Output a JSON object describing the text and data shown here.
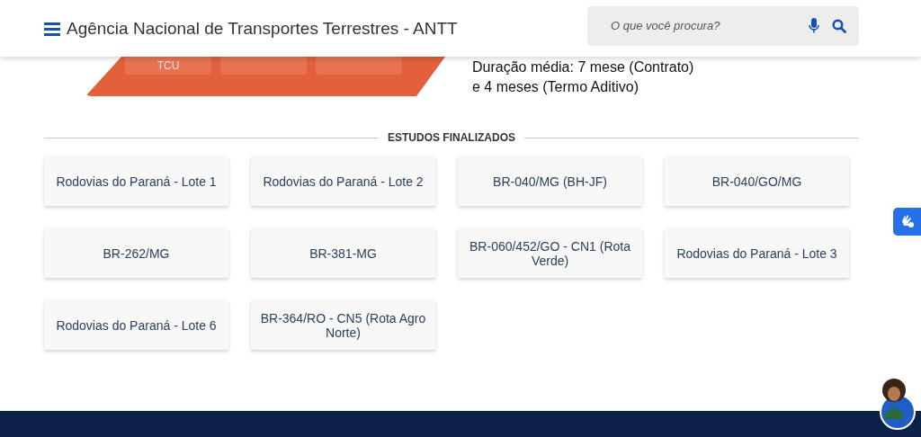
{
  "header": {
    "title": "Agência Nacional de Transportes Terrestres - ANTT",
    "search": {
      "placeholder": "O que você procura?"
    }
  },
  "banner": {
    "tiles": [
      "TCU"
    ],
    "lines": [
      "Duração média: 7 mese (Contrato)",
      "e 4 meses (Termo Aditivo)"
    ]
  },
  "section": {
    "title": "ESTUDOS FINALIZADOS",
    "cards": [
      {
        "label": "Rodovias do Paraná - Lote 1"
      },
      {
        "label": "Rodovias do Paraná - Lote 2"
      },
      {
        "label": "BR-040/MG (BH-JF)"
      },
      {
        "label": "BR-040/GO/MG"
      },
      {
        "label": "BR-262/MG"
      },
      {
        "label": "BR-381-MG"
      },
      {
        "label": "BR-060/452/GO - CN1 (Rota Verde)"
      },
      {
        "label": "Rodovias do Paraná - Lote 3"
      },
      {
        "label": "Rodovias do Paraná - Lote 6"
      },
      {
        "label": "BR-364/RO - CN5 (Rota Agro Norte)"
      }
    ]
  }
}
